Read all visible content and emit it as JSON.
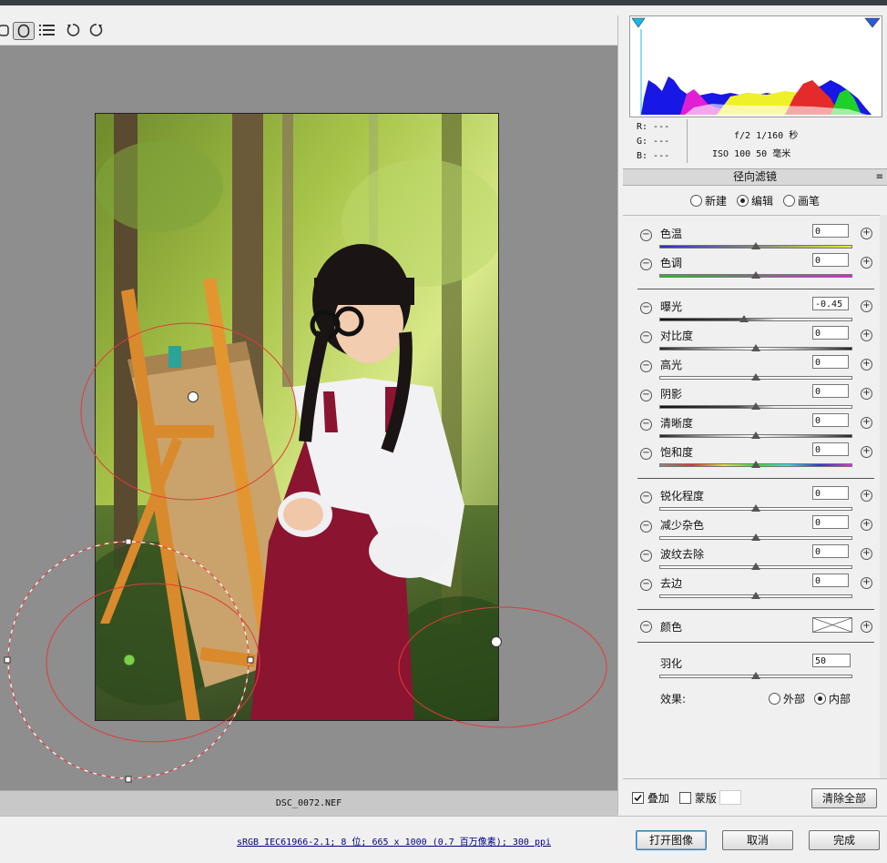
{
  "toolbar": {
    "icons": [
      "hand-icon",
      "radial-filter-icon",
      "list-icon",
      "rotate-left-icon",
      "rotate-right-icon"
    ]
  },
  "file": {
    "name": "DSC_0072.NEF"
  },
  "info": {
    "r": "R:  ---",
    "g": "G:  ---",
    "b": "B:  ---",
    "aperture_shutter": "f/2  1/160 秒",
    "iso_focal": "ISO 100  50 毫米"
  },
  "panel": {
    "title": "径向滤镜",
    "modes": [
      {
        "label": "新建",
        "selected": false
      },
      {
        "label": "编辑",
        "selected": true
      },
      {
        "label": "画笔",
        "selected": false
      }
    ],
    "sliders": [
      {
        "label": "色温",
        "value": "0",
        "fraction": 0.5,
        "track": "temp"
      },
      {
        "label": "色调",
        "value": "0",
        "fraction": 0.5,
        "track": "tint"
      },
      {
        "label": "曝光",
        "value": "-0.45",
        "fraction": 0.44,
        "track": "black"
      },
      {
        "label": "对比度",
        "value": "0",
        "fraction": 0.5,
        "track": "gray"
      },
      {
        "label": "高光",
        "value": "0",
        "fraction": 0.5,
        "track": "white"
      },
      {
        "label": "阴影",
        "value": "0",
        "fraction": 0.5,
        "track": "black"
      },
      {
        "label": "清晰度",
        "value": "0",
        "fraction": 0.5,
        "track": "gray"
      },
      {
        "label": "饱和度",
        "value": "0",
        "fraction": 0.5,
        "track": "rainbow"
      },
      {
        "label": "锐化程度",
        "value": "0",
        "fraction": 0.5,
        "track": "white"
      },
      {
        "label": "减少杂色",
        "value": "0",
        "fraction": 0.5,
        "track": "white"
      },
      {
        "label": "波纹去除",
        "value": "0",
        "fraction": 0.5,
        "track": "white"
      },
      {
        "label": "去边",
        "value": "0",
        "fraction": 0.5,
        "track": "white"
      }
    ],
    "color_label": "颜色",
    "feather": {
      "label": "羽化",
      "value": "50",
      "fraction": 0.5
    },
    "effect": {
      "label": "效果:",
      "options": [
        {
          "label": "外部",
          "selected": false
        },
        {
          "label": "内部",
          "selected": true
        }
      ]
    }
  },
  "bottom": {
    "overlay_label": "叠加",
    "overlay_checked": true,
    "mask_label": "蒙版",
    "mask_checked": false,
    "clear_all": "清除全部"
  },
  "status": {
    "link": "sRGB IEC61966-2.1; 8 位; 665 x 1000 (0.7 百万像素); 300 ppi",
    "open": "打开图像",
    "cancel": "取消",
    "done": "完成"
  }
}
